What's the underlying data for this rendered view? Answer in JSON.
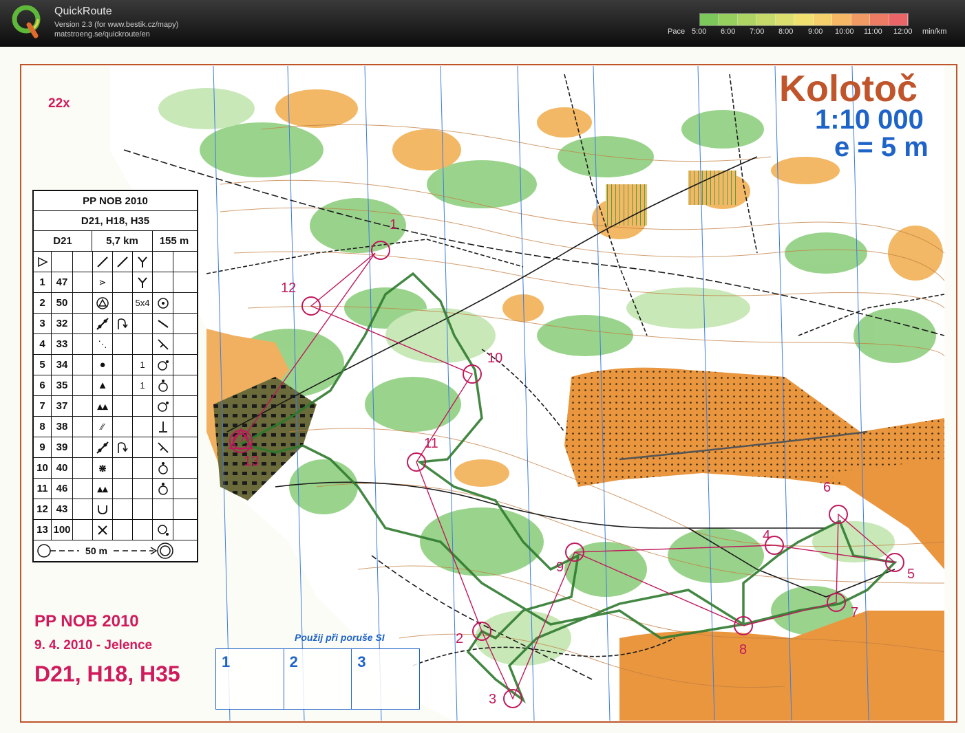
{
  "app": {
    "name": "QuickRoute",
    "version": "Version 2.3  (for www.bestik.cz/mapy)",
    "url": "matstroeng.se/quickroute/en"
  },
  "pace_legend": {
    "label": "Pace",
    "ticks": [
      "5:00",
      "6:00",
      "7:00",
      "8:00",
      "9:00",
      "10:00",
      "11:00",
      "12:00"
    ],
    "unit": "min/km",
    "colors": [
      "#7cc85a",
      "#96cf5e",
      "#aed563",
      "#c5da68",
      "#dcdf6d",
      "#efe06f",
      "#f6d06a",
      "#f6b864",
      "#f29a63",
      "#ee7b63",
      "#ea6567"
    ]
  },
  "map": {
    "title": "Kolotoč",
    "scale": "1:10 000",
    "contour": "e = 5 m",
    "copies": "22x",
    "event_name": "PP NOB 2010",
    "event_date": "9. 4. 2010 - Jelence",
    "event_classes": "D21, H18, H35"
  },
  "control_description": {
    "event": "PP NOB 2010",
    "classes": "D21, H18, H35",
    "class": "D21",
    "length": "5,7 km",
    "climb": "155 m",
    "rows": [
      {
        "num": "1",
        "code": "47",
        "extra": ""
      },
      {
        "num": "2",
        "code": "50",
        "extra": "5x4"
      },
      {
        "num": "3",
        "code": "32",
        "extra": ""
      },
      {
        "num": "4",
        "code": "33",
        "extra": ""
      },
      {
        "num": "5",
        "code": "34",
        "extra": "1"
      },
      {
        "num": "6",
        "code": "35",
        "extra": "1"
      },
      {
        "num": "7",
        "code": "37",
        "extra": ""
      },
      {
        "num": "8",
        "code": "38",
        "extra": ""
      },
      {
        "num": "9",
        "code": "39",
        "extra": ""
      },
      {
        "num": "10",
        "code": "40",
        "extra": ""
      },
      {
        "num": "11",
        "code": "46",
        "extra": ""
      },
      {
        "num": "12",
        "code": "43",
        "extra": ""
      },
      {
        "num": "13",
        "code": "100",
        "extra": ""
      }
    ],
    "finish_distance": "50 m"
  },
  "backup": {
    "title": "Použij  při poruše SI",
    "boxes": [
      "1",
      "2",
      "3"
    ]
  },
  "controls": [
    {
      "label": "1"
    },
    {
      "label": "2"
    },
    {
      "label": "3"
    },
    {
      "label": "4"
    },
    {
      "label": "5"
    },
    {
      "label": "6"
    },
    {
      "label": "7"
    },
    {
      "label": "8"
    },
    {
      "label": "9"
    },
    {
      "label": "10"
    },
    {
      "label": "11"
    },
    {
      "label": "12"
    },
    {
      "label": "13"
    }
  ]
}
